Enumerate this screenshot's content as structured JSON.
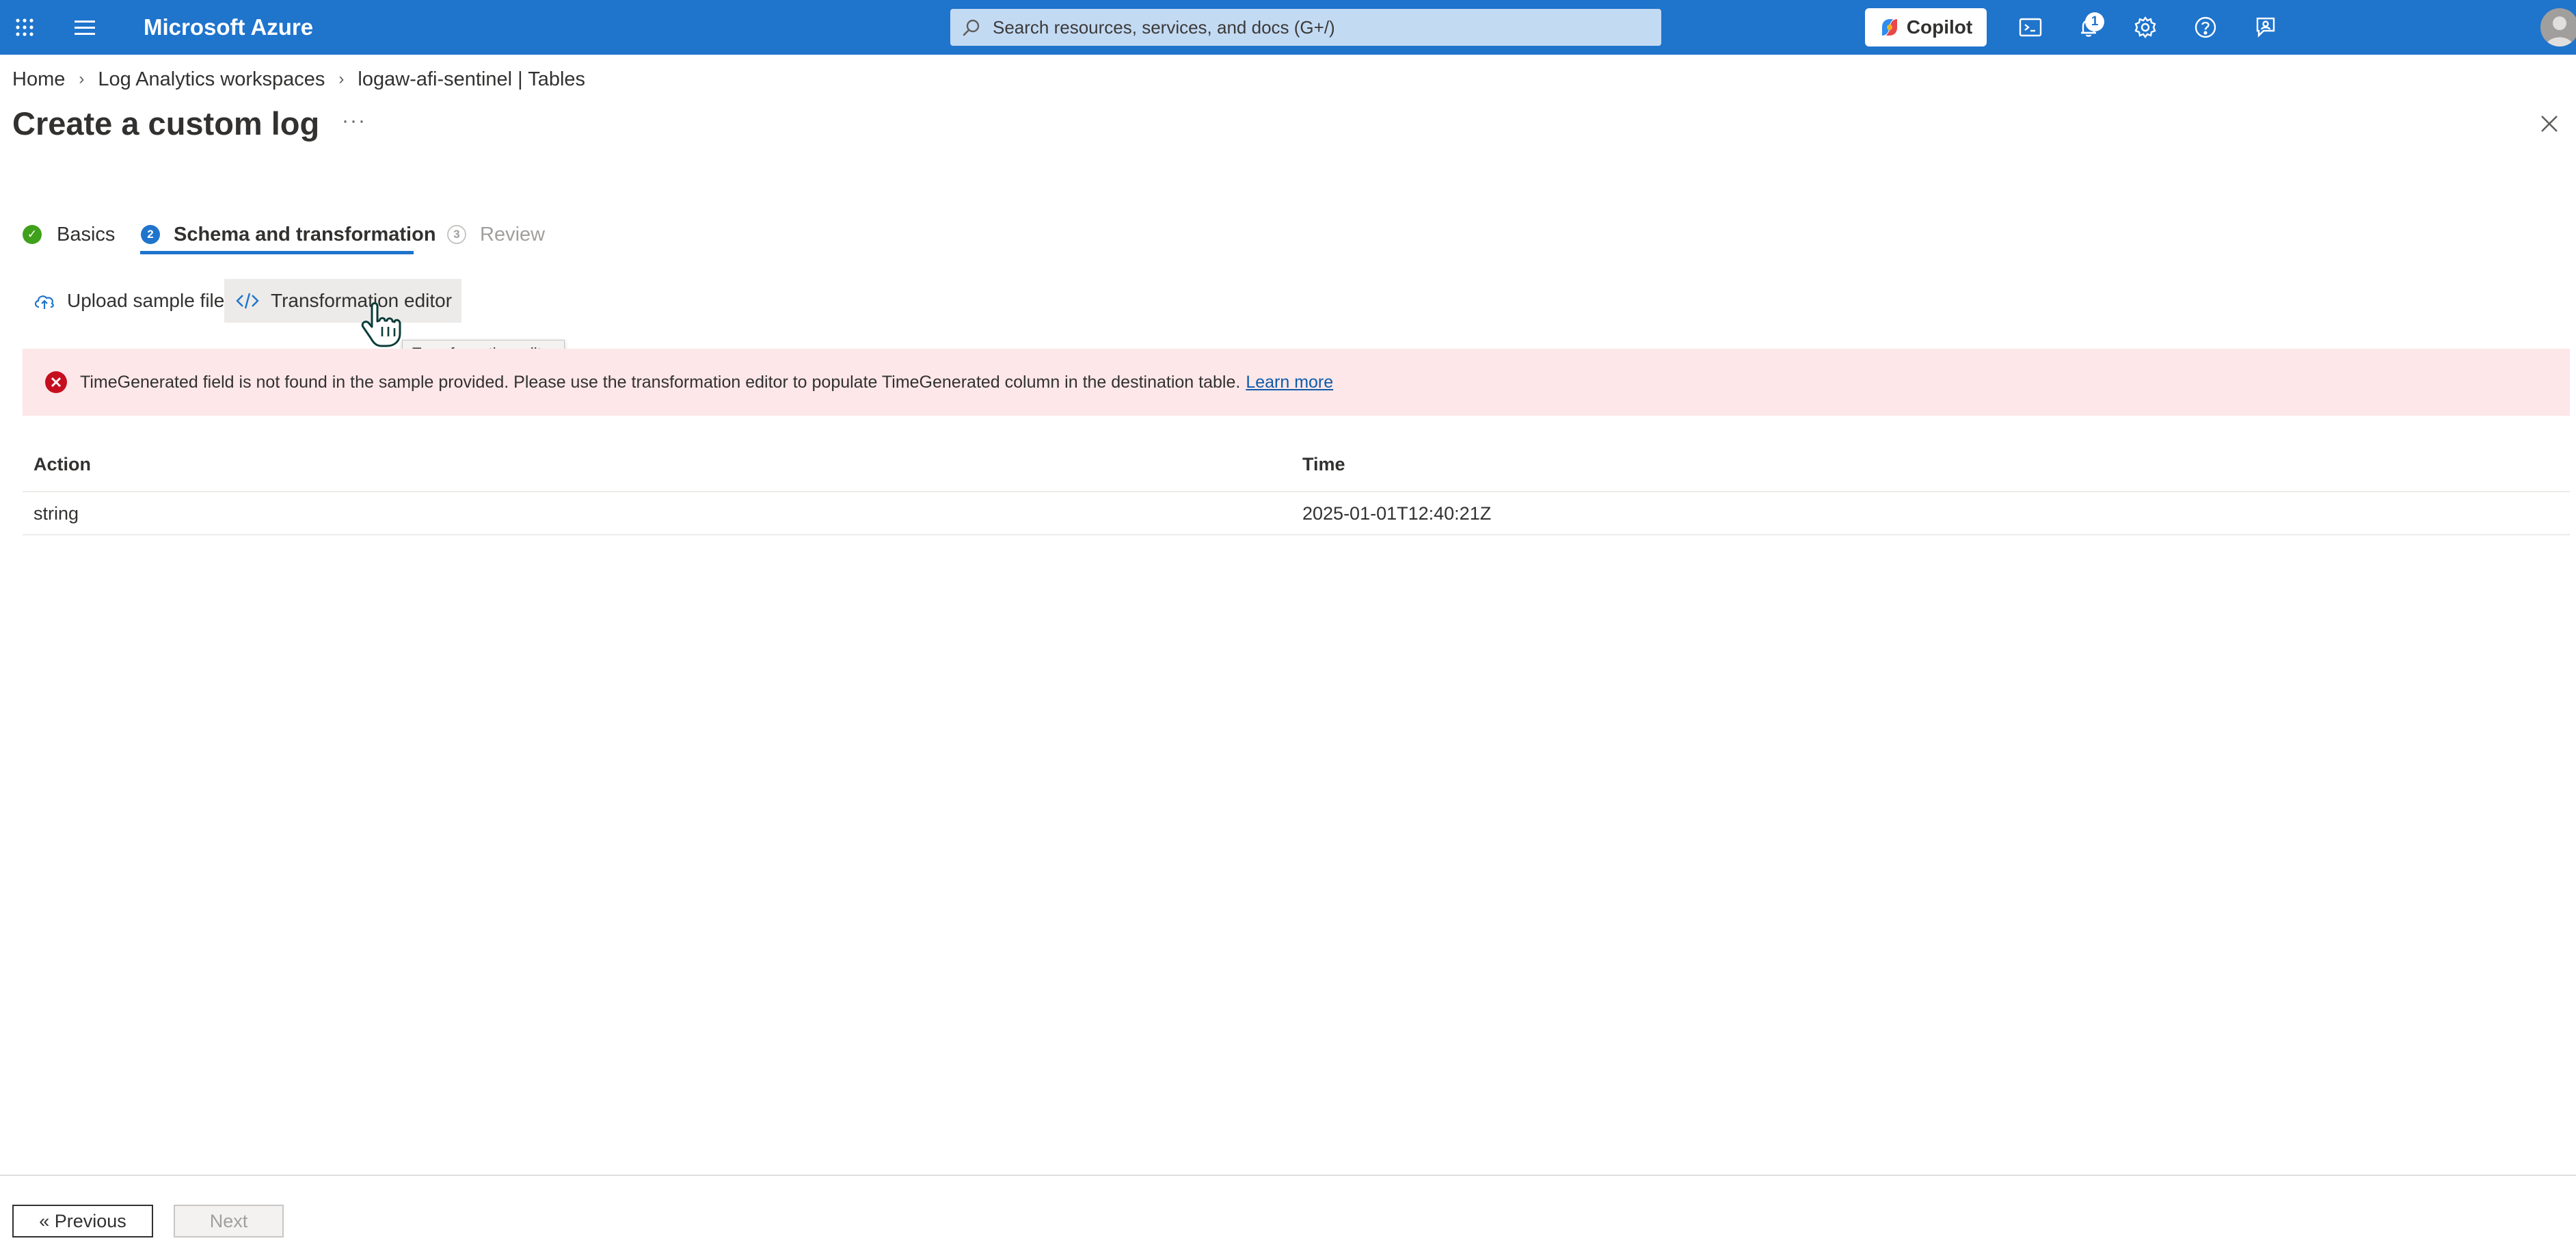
{
  "topbar": {
    "brand": "Microsoft Azure",
    "search_placeholder": "Search resources, services, and docs (G+/)",
    "copilot_label": "Copilot",
    "notifications_count": "1",
    "bg_color": "#1f74cc"
  },
  "breadcrumb": {
    "items": [
      "Home",
      "Log Analytics workspaces",
      "logaw-afi-sentinel | Tables"
    ]
  },
  "page": {
    "title": "Create a custom log",
    "more": "···"
  },
  "wizard": {
    "tabs": [
      {
        "number": "✓",
        "label": "Basics",
        "state": "complete"
      },
      {
        "number": "2",
        "label": "Schema and transformation",
        "state": "active"
      },
      {
        "number": "3",
        "label": "Review",
        "state": "disabled"
      }
    ]
  },
  "commands": {
    "upload_label": "Upload sample file",
    "editor_label": "Transformation editor",
    "tooltip": "Transformation editor"
  },
  "error": {
    "message": "TimeGenerated field is not found in the sample provided. Please use the transformation editor to populate TimeGenerated column in the destination table.",
    "link": "Learn more",
    "color": "#c50f1f"
  },
  "table": {
    "columns": [
      "Action",
      "Time"
    ],
    "rows": [
      [
        "string",
        "2025-01-01T12:40:21Z"
      ]
    ]
  },
  "footer": {
    "previous_label": "« Previous",
    "next_label": "Next"
  }
}
